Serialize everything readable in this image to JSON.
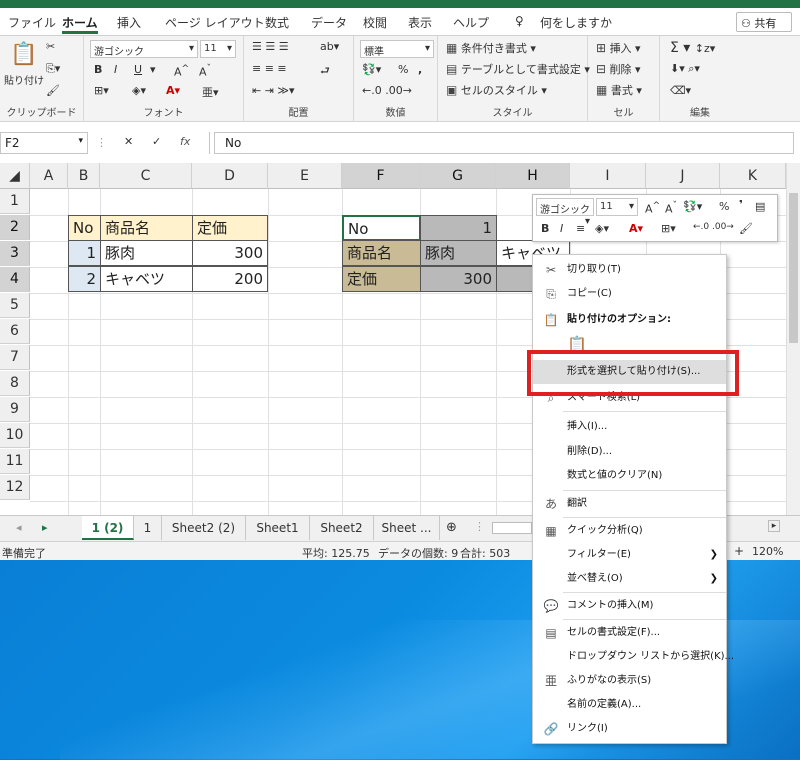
{
  "ribbon_tabs": [
    "ファイル",
    "ホーム",
    "挿入",
    "ページ レイアウト",
    "数式",
    "データ",
    "校閲",
    "表示",
    "ヘルプ",
    "何をしますか"
  ],
  "share_label": "共有",
  "clipboard": {
    "paste_label": "貼り付け",
    "group_label": "クリップボード"
  },
  "font": {
    "name": "游ゴシック",
    "size": "11",
    "bold": "B",
    "italic": "I",
    "underline": "U",
    "group_label": "フォント"
  },
  "alignment": {
    "group_label": "配置"
  },
  "number": {
    "format": "標準",
    "percent": "%",
    "comma": ",",
    "group_label": "数値"
  },
  "styles": {
    "conditional": "条件付き書式",
    "as_table": "テーブルとして書式設定",
    "cell_styles": "セルのスタイル",
    "group_label": "スタイル"
  },
  "cells": {
    "insert": "挿入",
    "delete": "削除",
    "format": "書式",
    "group_label": "セル"
  },
  "editing": {
    "group_label": "編集"
  },
  "formula_bar": {
    "name_box": "F2",
    "fx": "fx",
    "value": "No"
  },
  "columns": [
    "A",
    "B",
    "C",
    "D",
    "E",
    "F",
    "G",
    "H",
    "I",
    "J",
    "K"
  ],
  "rows": [
    "1",
    "2",
    "3",
    "4",
    "5",
    "6",
    "7",
    "8",
    "9",
    "10",
    "11",
    "12"
  ],
  "table1": {
    "h_no": "No",
    "h_name": "商品名",
    "h_price": "定価",
    "r1_no": "1",
    "r1_name": "豚肉",
    "r1_price": "300",
    "r2_no": "2",
    "r2_name": "キャベツ",
    "r2_price": "200"
  },
  "table2": {
    "no": "No",
    "no_val": "1",
    "name": "商品名",
    "name_val": "豚肉",
    "name_val2": "キャベツ",
    "price": "定価",
    "price_val": "300"
  },
  "mini_toolbar": {
    "font": "游ゴシック",
    "size": "11",
    "bold": "B",
    "italic": "I",
    "percent": "%"
  },
  "sheet_tabs": [
    "1 (2)",
    "1",
    "Sheet2 (2)",
    "Sheet1",
    "Sheet2",
    "Sheet ..."
  ],
  "status": {
    "ready": "準備完了",
    "avg": "平均: 125.75",
    "count": "データの個数: 9",
    "sum": "合計: 503",
    "zoom": "120%"
  },
  "context_menu": {
    "cut": "切り取り(T)",
    "copy": "コピー(C)",
    "paste_options": "貼り付けのオプション:",
    "paste_special": "形式を選択して貼り付け(S)...",
    "smart_lookup": "スマート検索(L)",
    "insert": "挿入(I)...",
    "delete": "削除(D)...",
    "clear": "数式と値のクリア(N)",
    "translate": "翻訳",
    "quick_analysis": "クイック分析(Q)",
    "filter": "フィルター(E)",
    "sort": "並べ替え(O)",
    "insert_comment": "コメントの挿入(M)",
    "format_cells": "セルの書式設定(F)...",
    "pick_list": "ドロップダウン リストから選択(K)...",
    "phonetic": "ふりがなの表示(S)",
    "define_name": "名前の定義(A)...",
    "link": "リンク(I)"
  },
  "colors": {
    "excel_green": "#217346",
    "highlight": "#e02020",
    "header_fill": "#fff2cc"
  }
}
